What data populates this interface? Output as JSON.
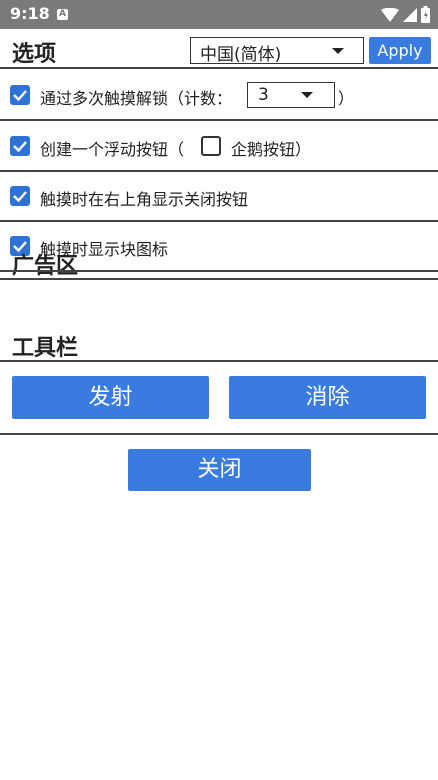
{
  "status_bar": {
    "time": "9:18",
    "notification_badge": "A"
  },
  "options": {
    "title": "选项",
    "language": {
      "selected": "中国(简体)"
    },
    "apply_label": "Apply",
    "items": [
      {
        "label": "通过多次触摸解锁（计数：",
        "suffix": "）",
        "checked": true,
        "count": "3"
      },
      {
        "label": "创建一个浮动按钮（",
        "checked": true,
        "sub_label": "企鹅按钮）",
        "sub_checked": false
      },
      {
        "label": "触摸时在右上角显示关闭按钮",
        "checked": true
      },
      {
        "label": "触摸时显示块图标",
        "checked": true
      }
    ]
  },
  "ad_area": {
    "title": "广告区"
  },
  "toolbar": {
    "title": "工具栏",
    "fire_label": "发射",
    "clear_label": "消除"
  },
  "close_label": "关闭",
  "colors": {
    "accent": "#3a7be0",
    "checkbox": "#2f72d6",
    "statusbar": "#7a7a7a"
  }
}
